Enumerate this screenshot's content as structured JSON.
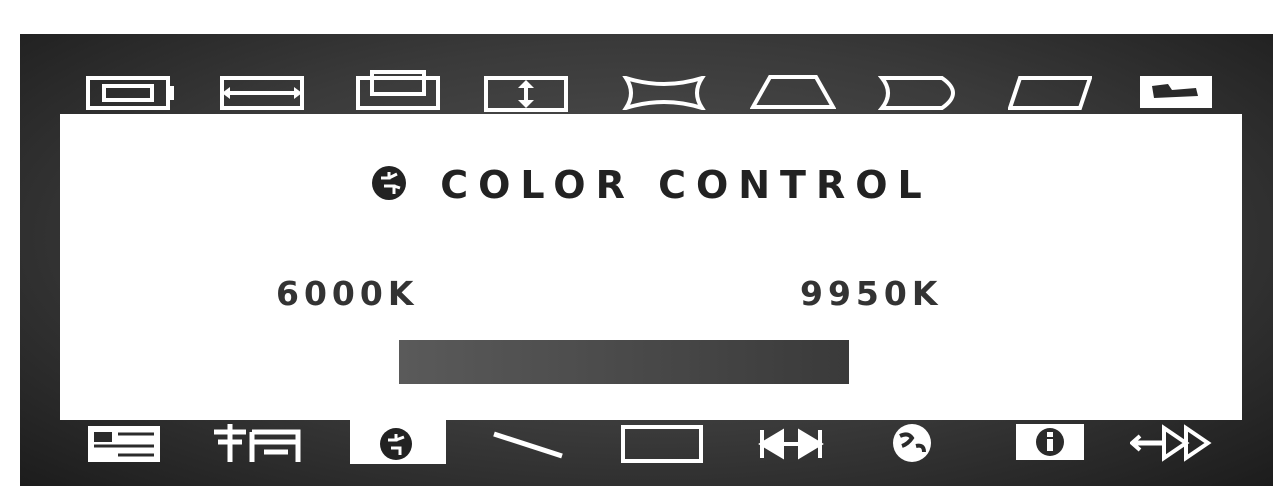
{
  "osd": {
    "title": "COLOR CONTROL",
    "title_icon": "color-palette-icon",
    "range": {
      "min_label": "6000K",
      "max_label": "9950K"
    },
    "slider": {
      "value_fraction": 1.0
    }
  },
  "top_tabs": [
    {
      "name": "h-size-icon"
    },
    {
      "name": "h-position-icon"
    },
    {
      "name": "v-size-icon"
    },
    {
      "name": "v-position-icon"
    },
    {
      "name": "pincushion-icon"
    },
    {
      "name": "trapezoid-icon"
    },
    {
      "name": "pin-balance-icon"
    },
    {
      "name": "parallelogram-icon"
    },
    {
      "name": "rotation-icon"
    }
  ],
  "bottom_tabs": [
    {
      "name": "osd-menu-icon"
    },
    {
      "name": "degauss-icon"
    },
    {
      "name": "color-control-icon",
      "selected": true
    },
    {
      "name": "moire-icon"
    },
    {
      "name": "geometry-icon"
    },
    {
      "name": "focus-icon"
    },
    {
      "name": "language-icon"
    },
    {
      "name": "info-icon"
    },
    {
      "name": "input-source-icon"
    }
  ],
  "colors": {
    "frame_dark": "#2b2b2b",
    "panel": "#ffffff",
    "text": "#222222",
    "slider": "#333333"
  }
}
